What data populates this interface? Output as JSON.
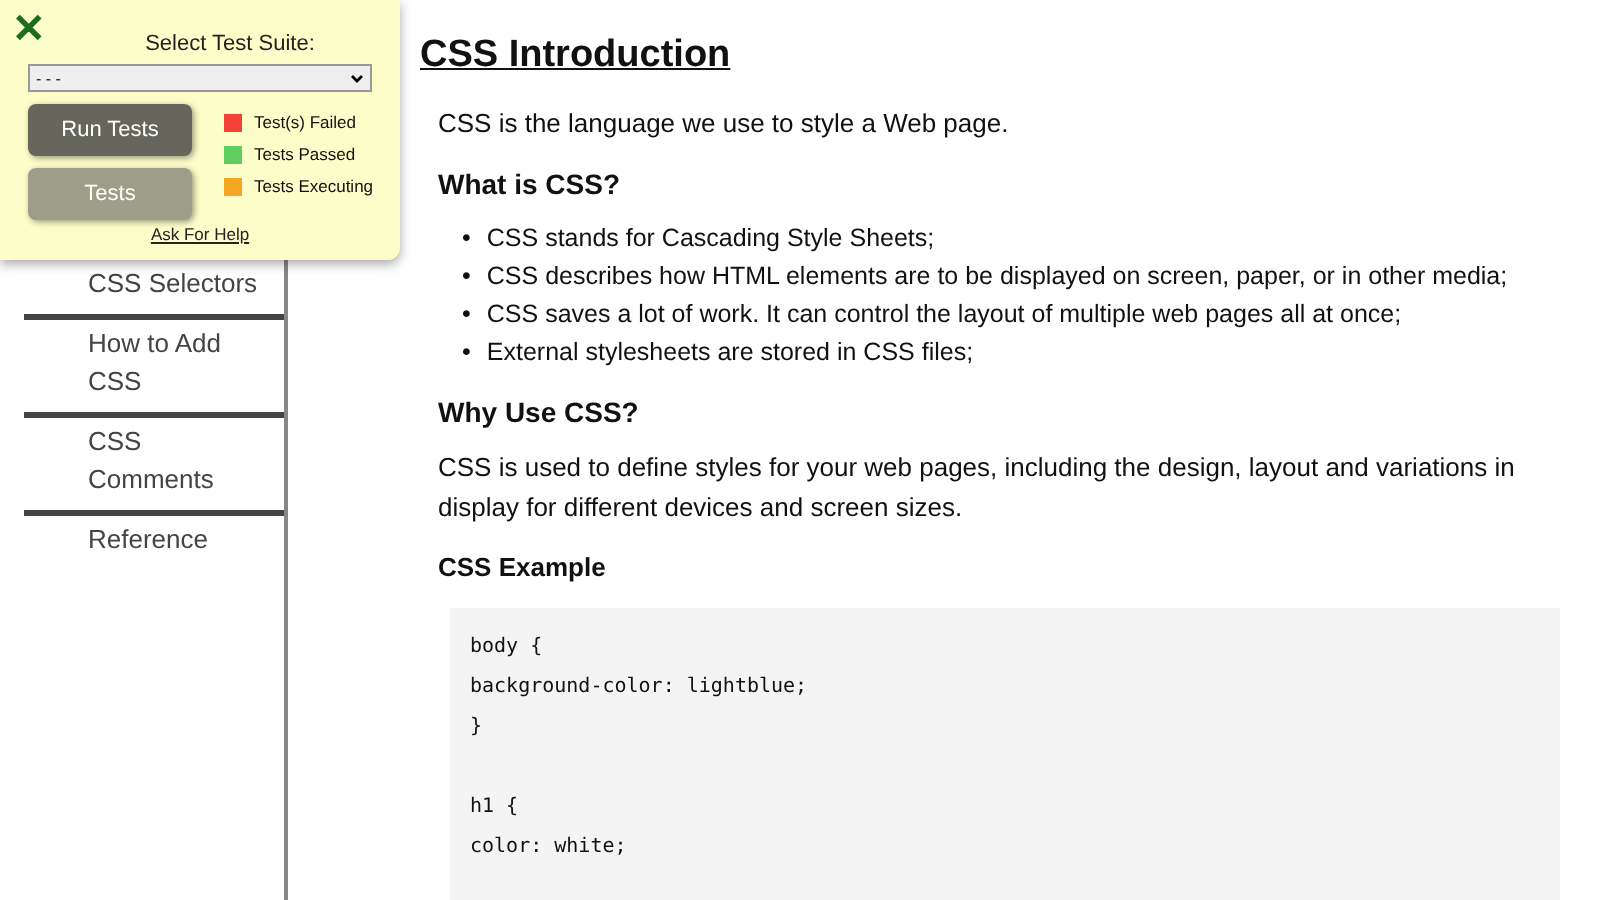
{
  "sidebar": {
    "items": [
      {
        "label": "CSS Selectors"
      },
      {
        "label": "How to Add CSS"
      },
      {
        "label": "CSS Comments"
      },
      {
        "label": "Reference"
      }
    ]
  },
  "test_panel": {
    "close": "✕",
    "title": "Select Test Suite:",
    "suite_select": {
      "value": "- - -"
    },
    "buttons": [
      "Run Tests",
      "Tests"
    ],
    "legend": [
      {
        "label": "Test(s) Failed",
        "color": "#f44336"
      },
      {
        "label": "Tests Passed",
        "color": "#5ecf5e"
      },
      {
        "label": "Tests Executing",
        "color": "#f5a623"
      }
    ],
    "help_link": "Ask For Help"
  },
  "content": {
    "title": "CSS Introduction",
    "intro": "CSS is the language we use to style a Web page.",
    "what_heading": "What is CSS?",
    "bullets": [
      {
        "marker": "•",
        "text": "CSS stands for Cascading Style Sheets;"
      },
      {
        "marker": "•",
        "text": "CSS describes how HTML elements are to be displayed on screen, paper, or in other media;"
      },
      {
        "marker": "•",
        "text": "CSS saves a lot of work. It can control the layout of multiple web pages all at once;"
      },
      {
        "marker": "•",
        "text": "External stylesheets are stored in CSS files;"
      }
    ],
    "why_heading": "Why Use CSS?",
    "why_text": "CSS is used to define styles for your web pages, including the design, layout and variations in display for different devices and screen sizes.",
    "example_heading": "CSS Example",
    "code_blocks": [
      [
        "body {",
        "background-color: lightblue;",
        "}"
      ],
      [
        "h1 {",
        "color: white;"
      ]
    ]
  }
}
